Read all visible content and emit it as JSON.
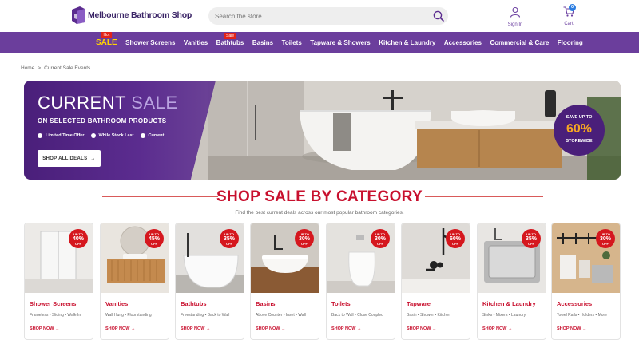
{
  "header": {
    "logo_text": "Melbourne Bathroom Shop",
    "search_placeholder": "Search the store",
    "signin_label": "Sign In",
    "cart_label": "Cart",
    "cart_count": "0"
  },
  "nav": {
    "items": [
      {
        "label": "SALE",
        "tag": "Hot"
      },
      {
        "label": "Shower Screens",
        "tag": ""
      },
      {
        "label": "Vanities",
        "tag": ""
      },
      {
        "label": "Bathtubs",
        "tag": "Sale"
      },
      {
        "label": "Basins",
        "tag": ""
      },
      {
        "label": "Toilets",
        "tag": ""
      },
      {
        "label": "Tapware & Showers",
        "tag": ""
      },
      {
        "label": "Kitchen & Laundry",
        "tag": ""
      },
      {
        "label": "Accessories",
        "tag": ""
      },
      {
        "label": "Commercial & Care",
        "tag": ""
      },
      {
        "label": "Flooring",
        "tag": ""
      }
    ]
  },
  "breadcrumb": {
    "home": "Home",
    "separator": ">",
    "current": "Current Sale Events"
  },
  "hero": {
    "title_main": "CURRENT",
    "title_accent": "SALE",
    "subtitle": "ON SELECTED BATHROOM PRODUCTS",
    "bullets": [
      "Limited Time Offer",
      "While Stock Last",
      "Current"
    ],
    "button_label": "SHOP ALL DEALS",
    "save_top": "SAVE UP TO",
    "save_pct": "60%",
    "save_bottom": "STOREWIDE"
  },
  "section": {
    "title": "SHOP SALE BY CATEGORY",
    "subtitle": "Find the best current deals across our most popular bathroom categories."
  },
  "badge_text": {
    "top": "UP TO",
    "bottom": "OFF"
  },
  "categories": [
    {
      "name": "Shower Screens",
      "desc": "Frameless • Sliding • Walk-In",
      "pct": "40%",
      "link": "SHOP NOW"
    },
    {
      "name": "Vanities",
      "desc": "Wall Hung • Floorstanding",
      "pct": "45%",
      "link": "SHOP NOW"
    },
    {
      "name": "Bathtubs",
      "desc": "Freestanding • Back to Wall",
      "pct": "35%",
      "link": "SHOP NOW"
    },
    {
      "name": "Basins",
      "desc": "Above Counter • Inset • Wall",
      "pct": "30%",
      "link": "SHOP NOW"
    },
    {
      "name": "Toilets",
      "desc": "Back to Wall • Close Coupled",
      "pct": "30%",
      "link": "SHOP NOW"
    },
    {
      "name": "Tapware",
      "desc": "Basin • Shower • Kitchen",
      "pct": "60%",
      "link": "SHOP NOW"
    },
    {
      "name": "Kitchen & Laundry",
      "desc": "Sinks • Mixers • Laundry",
      "pct": "35%",
      "link": "SHOP NOW"
    },
    {
      "name": "Accessories",
      "desc": "Towel Rails • Holders • More",
      "pct": "30%",
      "link": "SHOP NOW"
    }
  ],
  "colors": {
    "brand_purple": "#6b3e9c",
    "sale_red": "#c8102e",
    "sale_yellow": "#ffd400",
    "accent_orange": "#f5a623"
  }
}
